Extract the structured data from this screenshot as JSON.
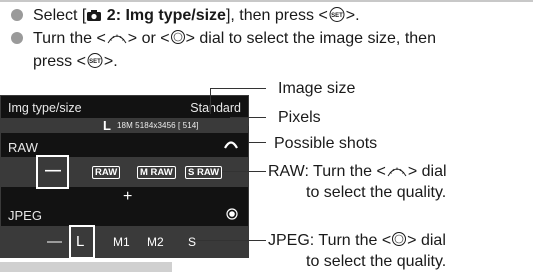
{
  "steps": [
    {
      "pre": "Select [",
      "menu_icon": "camera-icon",
      "bold": " 2: Img type/size",
      "post": "], then press <",
      "button_icon": "set-button-icon",
      "end": ">."
    },
    {
      "pre": "Turn the <",
      "dial1_icon": "main-dial-icon",
      "mid": "> or <",
      "dial2_icon": "quick-control-dial-icon",
      "end": "> dial to select the image size, then",
      "cont_pre": "press <",
      "cont_icon": "set-button-icon",
      "cont_end": ">."
    }
  ],
  "screen": {
    "title": "Img type/size",
    "mode": "Standard",
    "size_icon": "L",
    "pixels_text": "18M 5184x3456 [ 514]",
    "raw_label": "RAW",
    "raw_options": [
      "—",
      "RAW",
      "M RAW",
      "S RAW"
    ],
    "plus": "+",
    "jpeg_label": "JPEG",
    "jpeg_options": [
      "—",
      "L",
      "M1",
      "M2",
      "S"
    ]
  },
  "callouts": {
    "image_size": "Image size",
    "pixels": "Pixels",
    "possible_shots": "Possible shots",
    "raw_line1": "RAW: Turn the <",
    "raw_line1_end": "> dial",
    "raw_line2": "to select the quality.",
    "jpeg_line1": "JPEG: Turn the <",
    "jpeg_line1_end": "> dial",
    "jpeg_line2": "to select the quality."
  },
  "colors": {
    "screen_bg": "#121212",
    "band": "#3a3a3a",
    "bullet": "#9a9a9a"
  }
}
